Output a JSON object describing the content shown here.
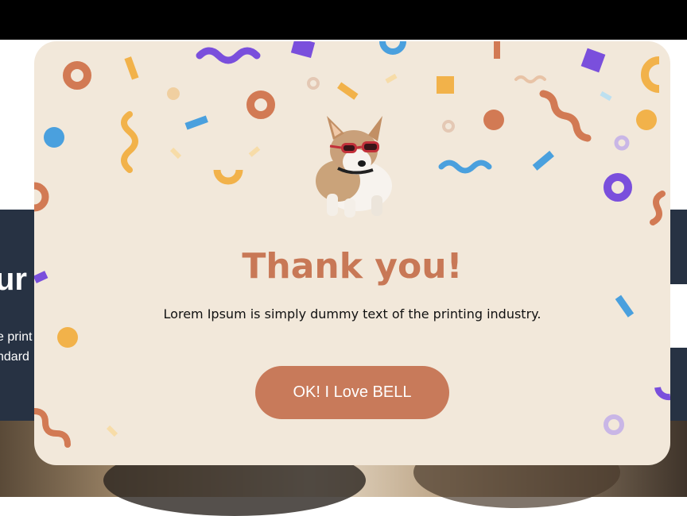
{
  "background": {
    "heading_partial": "ur",
    "text_line1": "e print",
    "text_line2": "ndard"
  },
  "modal": {
    "title": "Thank you!",
    "description": "Lorem Ipsum is simply dummy text of the printing industry.",
    "ok_button_label": "OK! I Love BELL",
    "image_icon": "corgi-with-goggles",
    "colors": {
      "title": "#c87856",
      "button": "#c87a5a",
      "background": "#f2e8da",
      "confetti_orange": "#d27a54",
      "confetti_yellow": "#f2b24a",
      "confetti_blue": "#4aa0de",
      "confetti_purple": "#7a4fdc",
      "confetti_lavender": "#c9b6e6"
    }
  }
}
